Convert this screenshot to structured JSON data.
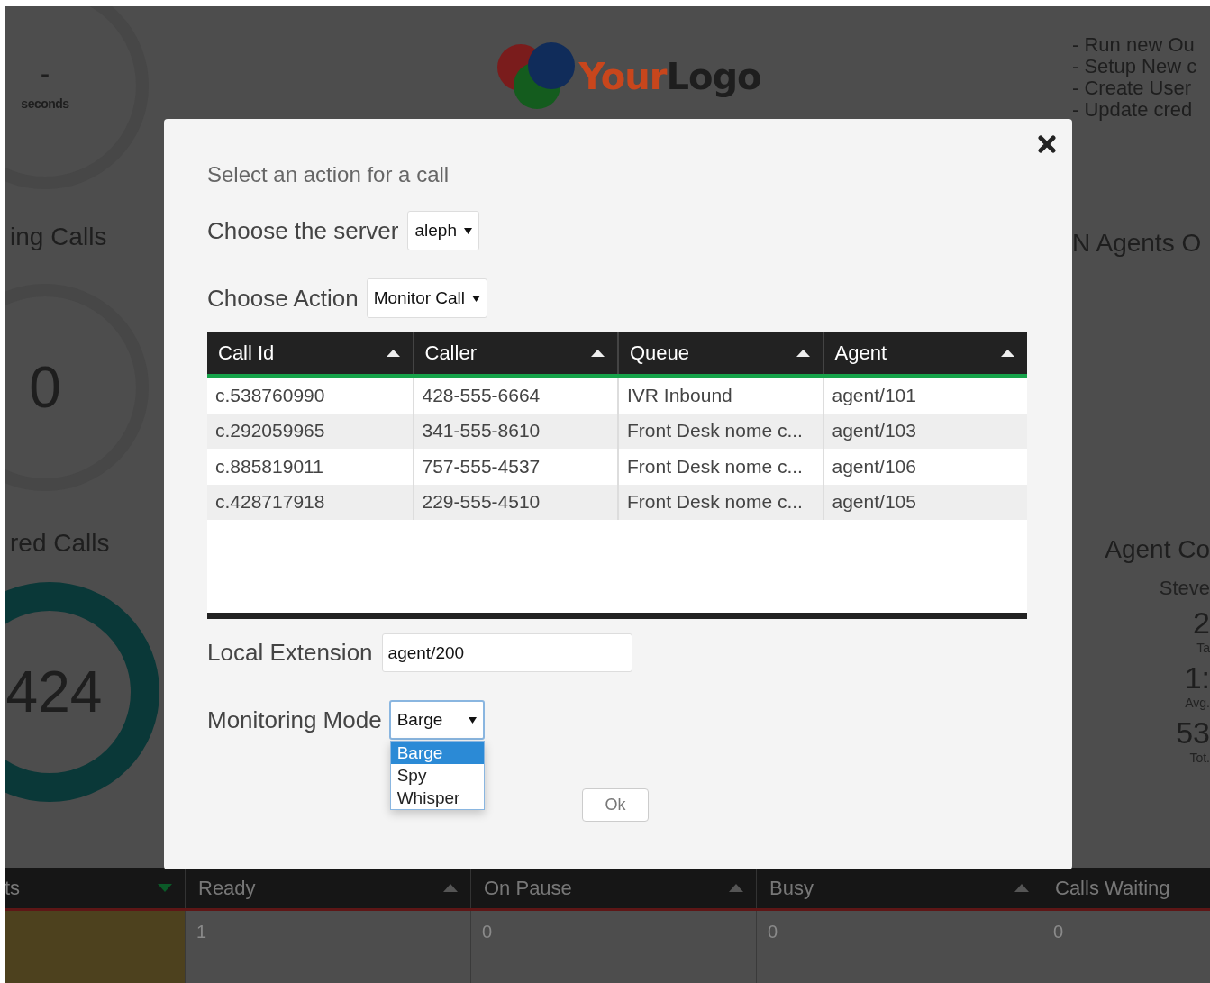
{
  "background": {
    "left_panel": {
      "timer_value": "-",
      "timer_unit": "seconds",
      "waiting_title": "ing Calls",
      "waiting_count": "0",
      "answered_title": "red Calls",
      "answered_count": "424"
    },
    "logo": {
      "part_1": "Your",
      "part_2": "Logo"
    },
    "right_panel": {
      "links": [
        "- Run new Ou",
        "- Setup New c",
        "- Create User",
        "- Update cred"
      ],
      "agents_title": "N Agents O",
      "agent_title": "Agent Co",
      "agent_name": "Steve",
      "stats": [
        {
          "value": "2",
          "label": "Ta"
        },
        {
          "value": "1:",
          "label": "Avg."
        },
        {
          "value": "53",
          "label": "Tot."
        }
      ]
    },
    "summary_table": {
      "columns": [
        {
          "label": "ts",
          "sort_descending": true
        },
        {
          "label": "Ready",
          "sort_descending": false
        },
        {
          "label": "On Pause",
          "sort_descending": false
        },
        {
          "label": "Busy",
          "sort_descending": false
        },
        {
          "label": "Calls Waiting"
        }
      ],
      "rows": [
        {
          "cells": [
            "",
            "1",
            "0",
            "0",
            "0"
          ]
        }
      ]
    }
  },
  "dialog": {
    "intro": "Select an action for a call",
    "server": {
      "label": "Choose the server",
      "value": "aleph"
    },
    "action": {
      "label": "Choose Action",
      "value": "Monitor Call"
    },
    "calls_table": {
      "columns": [
        {
          "label": "Call Id",
          "sort_descending": false
        },
        {
          "label": "Caller",
          "sort_descending": false
        },
        {
          "label": "Queue",
          "sort_descending": false
        },
        {
          "label": "Agent",
          "sort_descending": false
        }
      ],
      "rows": [
        {
          "call_id": "c.538760990",
          "caller": "428-555-6664",
          "queue": "IVR Inbound",
          "agent": "agent/101"
        },
        {
          "call_id": "c.292059965",
          "caller": "341-555-8610",
          "queue": "Front Desk nome c...",
          "agent": "agent/103"
        },
        {
          "call_id": "c.885819011",
          "caller": "757-555-4537",
          "queue": "Front Desk nome c...",
          "agent": "agent/106"
        },
        {
          "call_id": "c.428717918",
          "caller": "229-555-4510",
          "queue": "Front Desk nome c...",
          "agent": "agent/105"
        }
      ]
    },
    "local_extension": {
      "label": "Local Extension",
      "value": "agent/200"
    },
    "monitoring_mode": {
      "label": "Monitoring Mode",
      "value": "Barge",
      "expanded": true,
      "options": [
        {
          "label": "Barge",
          "selected": true
        },
        {
          "label": "Spy",
          "selected": false
        },
        {
          "label": "Whisper",
          "selected": false
        }
      ]
    },
    "ok_button": "Ok"
  }
}
